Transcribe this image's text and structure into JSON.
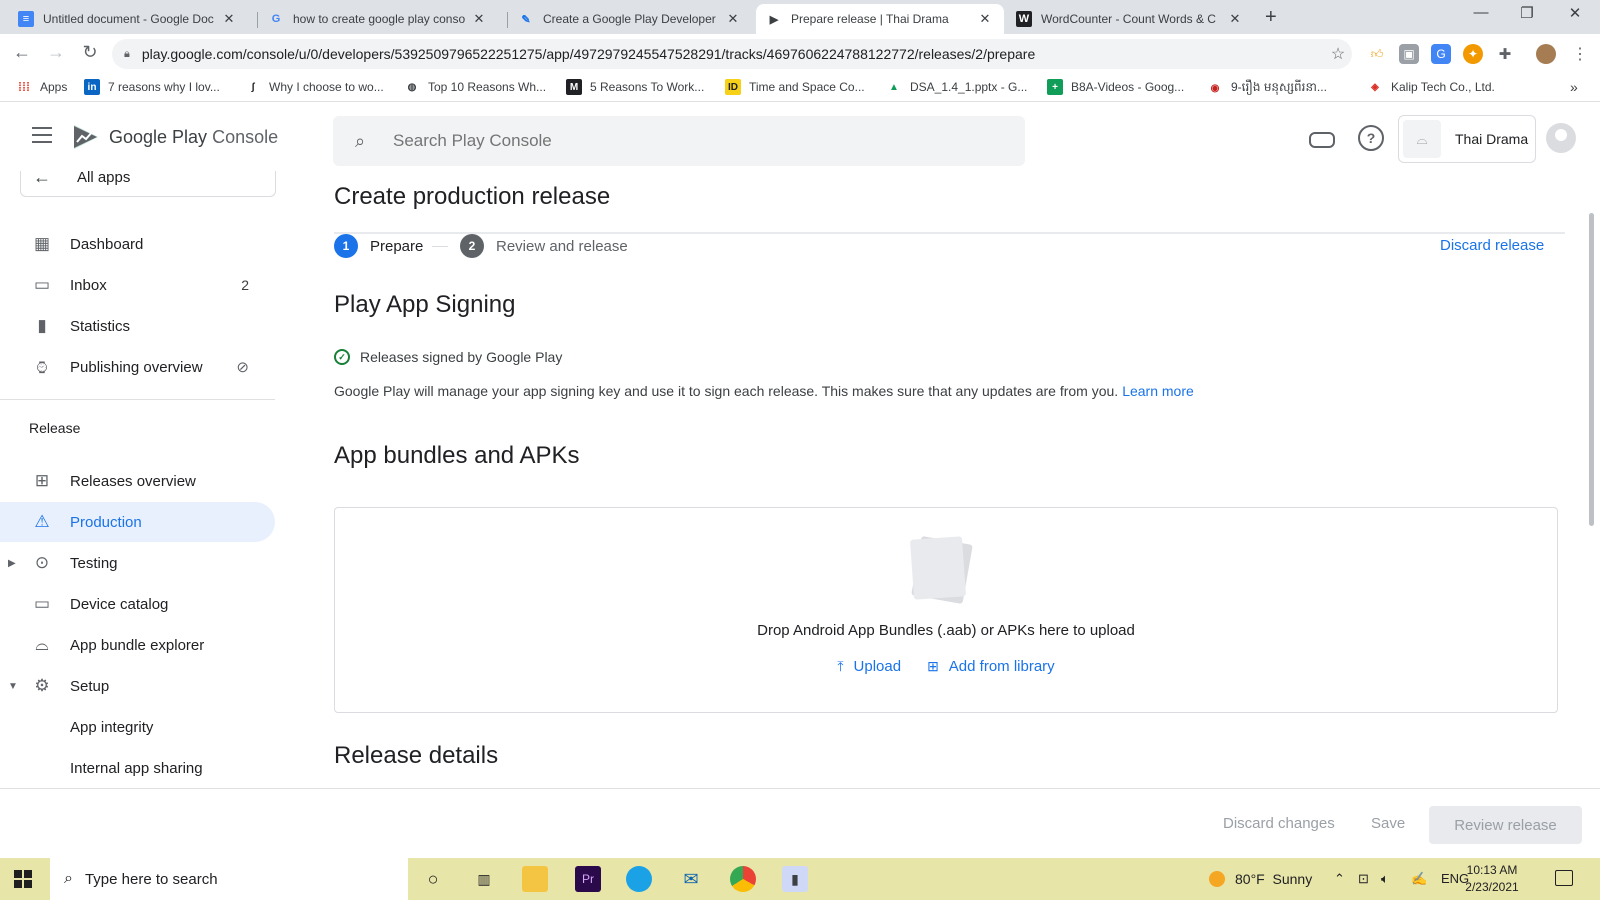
{
  "browser": {
    "tabs": [
      {
        "title": "Untitled document - Google Doc",
        "icon": "docs-icon"
      },
      {
        "title": "how to create google play conso",
        "icon": "google-icon"
      },
      {
        "title": "Create a Google Play Developer",
        "icon": "feather-icon"
      },
      {
        "title": "Prepare release | Thai Drama",
        "icon": "play-console-icon",
        "active": true
      },
      {
        "title": "WordCounter - Count Words & C",
        "icon": "w-icon"
      }
    ],
    "url": "play.google.com/console/u/0/developers/5392509796522251275/app/4972979245547528291/tracks/4697606224788122772/releases/2/prepare",
    "bookmarks": [
      {
        "label": "Apps"
      },
      {
        "label": "7 reasons why I lov..."
      },
      {
        "label": "Why I choose to wo..."
      },
      {
        "label": "Top 10 Reasons Wh..."
      },
      {
        "label": "5 Reasons To Work..."
      },
      {
        "label": "Time and Space Co..."
      },
      {
        "label": "DSA_1.4_1.pptx - G..."
      },
      {
        "label": "B8A-Videos - Goog..."
      },
      {
        "label": "9-រឿង មនុស្សពីរនា..."
      },
      {
        "label": "Kalip Tech Co., Ltd."
      }
    ]
  },
  "header": {
    "logo_google_play": "Google Play",
    "logo_console": "Console",
    "search_placeholder": "Search Play Console",
    "account_name": "Thai Drama"
  },
  "sidebar": {
    "all_apps": "All apps",
    "items": [
      {
        "label": "Dashboard"
      },
      {
        "label": "Inbox",
        "badge": "2"
      },
      {
        "label": "Statistics"
      },
      {
        "label": "Publishing overview"
      }
    ],
    "release_section": "Release",
    "release_items": [
      {
        "label": "Releases overview"
      },
      {
        "label": "Production"
      },
      {
        "label": "Testing"
      },
      {
        "label": "Device catalog"
      },
      {
        "label": "App bundle explorer"
      },
      {
        "label": "Setup"
      },
      {
        "label": "App integrity"
      },
      {
        "label": "Internal app sharing"
      }
    ]
  },
  "main": {
    "title": "Create production release",
    "steps": [
      {
        "num": "1",
        "label": "Prepare"
      },
      {
        "num": "2",
        "label": "Review and release"
      }
    ],
    "discard_release": "Discard release",
    "signing_title": "Play App Signing",
    "signed_status": "Releases signed by Google Play",
    "signing_desc": "Google Play will manage your app signing key and use it to sign each release. This makes sure that any updates are from you.",
    "learn_more": "Learn more",
    "bundles_title": "App bundles and APKs",
    "drop_text": "Drop Android App Bundles (.aab) or APKs here to upload",
    "upload": "Upload",
    "add_from_library": "Add from library",
    "release_details_title": "Release details"
  },
  "footer": {
    "discard_changes": "Discard changes",
    "save": "Save",
    "review_release": "Review release"
  },
  "taskbar": {
    "search_placeholder": "Type here to search",
    "temperature": "80°F",
    "weather": "Sunny",
    "language": "ENG",
    "time": "10:13 AM",
    "date": "2/23/2021"
  },
  "colors": {
    "accent": "#1a73e8",
    "active_nav_bg": "#e8f0fe",
    "success": "#188038",
    "taskbar": "#e8e5a8"
  }
}
